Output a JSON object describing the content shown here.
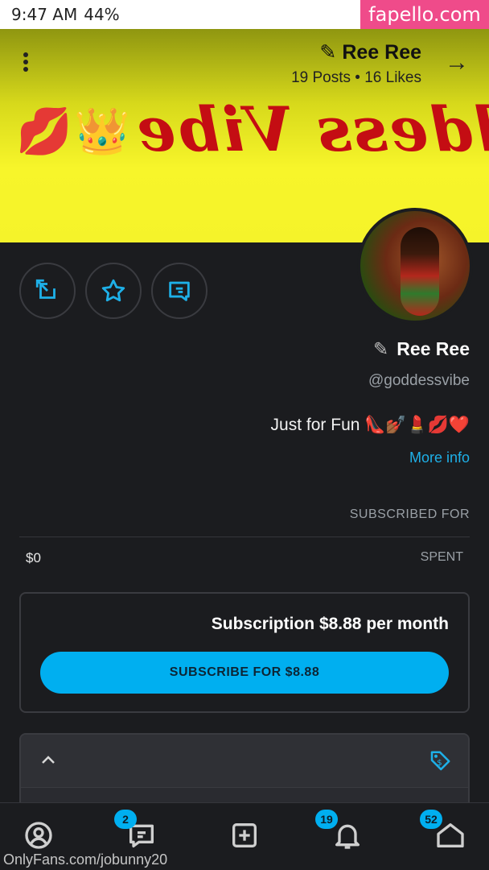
{
  "status_bar": {
    "time": "9:47 AM",
    "battery": "44%",
    "watermark": "fapello.com"
  },
  "header": {
    "name": "Ree Ree",
    "stats": "19 Posts • 16 Likes",
    "banner_text": "Goddess Vibe",
    "back_icon": "arrow-right-icon",
    "menu_icon": "kebab-icon"
  },
  "profile": {
    "display_name": "Ree Ree",
    "handle": "@goddessvibe",
    "bio": "Just for Fun 👠💅🏾💄💋❤️",
    "more_info": "More info"
  },
  "stats": {
    "subscribed_for": "SUBSCRIBED FOR",
    "spent_label": "SPENT",
    "spent_value": "$0"
  },
  "subscription": {
    "title": "Subscription $8.88 per month",
    "button": "SUBSCRIBE FOR $8.88"
  },
  "bottom_nav": {
    "home_badge": "52",
    "notifications_badge": "19",
    "messages_badge": "2"
  },
  "watermark_url": "OnlyFans.com/jobunny20",
  "colors": {
    "accent": "#00aff0",
    "banner_yellow": "#f5f32a",
    "banner_text": "#c40d13",
    "background": "#1b1c1f"
  }
}
